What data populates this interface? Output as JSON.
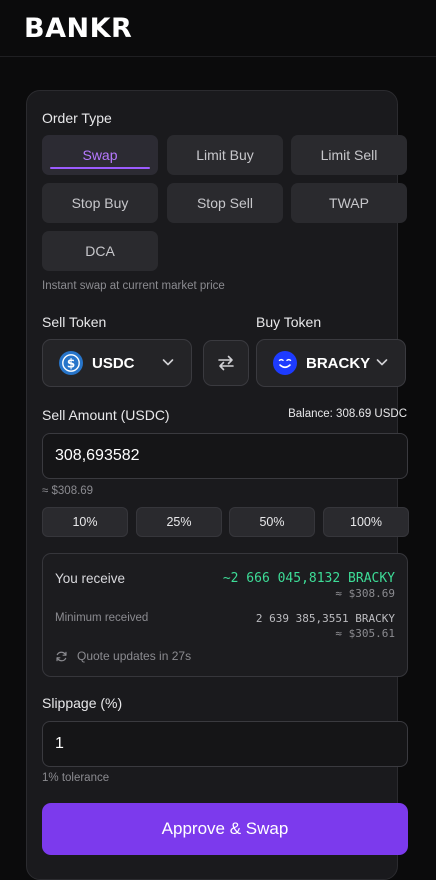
{
  "header": {
    "brand": "BANKR"
  },
  "order_type": {
    "title": "Order Type",
    "options": [
      "Swap",
      "Limit Buy",
      "Limit Sell",
      "Stop Buy",
      "Stop Sell",
      "TWAP",
      "DCA"
    ],
    "selected": "Swap",
    "description": "Instant swap at current market price"
  },
  "tokens": {
    "sell_label": "Sell Token",
    "buy_label": "Buy Token",
    "sell": {
      "symbol": "USDC",
      "icon": "usdc-logo"
    },
    "buy": {
      "symbol": "BRACKY",
      "icon": "bracky-logo"
    },
    "switch_icon": "swap-arrows-icon"
  },
  "amount": {
    "label": "Sell Amount (USDC)",
    "balance": "Balance: 308.69 USDC",
    "value": "308,693582",
    "usd": "≈ $308.69",
    "percents": [
      "10%",
      "25%",
      "50%",
      "100%"
    ]
  },
  "quote": {
    "receive_label": "You receive",
    "receive_amount": "~2 666 045,8132 BRACKY",
    "receive_usd": "≈ $308.69",
    "min_label": "Minimum received",
    "min_amount": "2 639 385,3551 BRACKY",
    "min_usd": "≈ $305.61",
    "refresh": "Quote updates in 27s"
  },
  "slippage": {
    "label": "Slippage (%)",
    "value": "1",
    "hint": "1% tolerance"
  },
  "cta": {
    "label": "Approve & Swap"
  },
  "colors": {
    "accent": "#7c3aed",
    "accent_text": "#b679ff",
    "positive": "#3ddc97",
    "usdc": "#2775ca",
    "bracky": "#1d3bff"
  }
}
